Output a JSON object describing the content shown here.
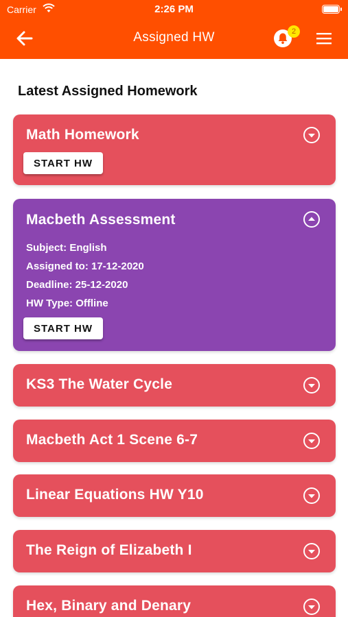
{
  "status_bar": {
    "carrier": "Carrier",
    "time": "2:26 PM"
  },
  "nav": {
    "title": "Assigned HW",
    "badge_count": "2",
    "back_icon": "arrow-left-icon",
    "bell_icon": "bell-icon",
    "menu_icon": "hamburger-menu-icon"
  },
  "section_title": "Latest Assigned Homework",
  "colors": {
    "header": "#FF4F00",
    "card_red": "#E5505C",
    "card_purple": "#8B45B0",
    "badge": "#FFE600"
  },
  "homework": [
    {
      "title": "Math Homework",
      "start_label": "START HW"
    },
    {
      "title": "Macbeth Assessment",
      "subject": "Subject: English",
      "assigned": "Assigned to: 17-12-2020",
      "deadline": "Deadline: 25-12-2020",
      "type": "HW Type: Offline",
      "start_label": "START HW"
    },
    {
      "title": "KS3 The Water Cycle"
    },
    {
      "title": "Macbeth Act 1 Scene 6-7"
    },
    {
      "title": "Linear Equations HW Y10"
    },
    {
      "title": "The Reign of Elizabeth I"
    },
    {
      "title": "Hex, Binary and Denary"
    }
  ]
}
